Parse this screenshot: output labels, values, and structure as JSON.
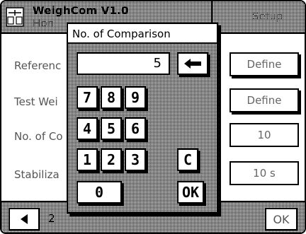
{
  "header": {
    "title": "WeighCom V1.0",
    "subtitle": "Hon",
    "setup_label": "Setup"
  },
  "rows": [
    {
      "label": "Referenc",
      "value": "Define"
    },
    {
      "label": "Test Wei",
      "value": "Define"
    },
    {
      "label": "No. of Co",
      "value": "10"
    },
    {
      "label": "Stabiliza",
      "value": "10 s"
    }
  ],
  "bottom": {
    "back_icon": "left-arrow-icon",
    "page_text": "2",
    "ok_label": "OK"
  },
  "popup": {
    "title": "No. of Comparison",
    "display_value": "5",
    "backspace_icon": "left-arrow-icon",
    "keys": {
      "k7": "7",
      "k8": "8",
      "k9": "9",
      "k4": "4",
      "k5": "5",
      "k6": "6",
      "k1": "1",
      "k2": "2",
      "k3": "3",
      "clear": "C",
      "k0": "0",
      "ok": "OK"
    }
  }
}
